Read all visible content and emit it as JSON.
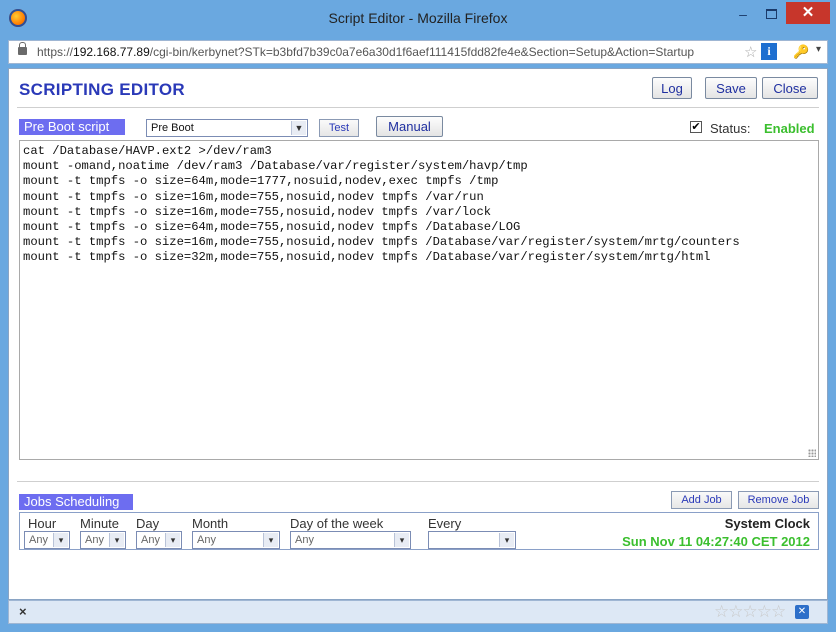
{
  "window": {
    "title": "Script Editor - Mozilla Firefox",
    "minimize": "–",
    "close": "✕"
  },
  "urlbar": {
    "scheme": "https://",
    "host": "192.168.77.89",
    "path": "/cgi-bin/kerbynet?STk=b3bfd7b39c0a7e6a30d1f6aef111415fdd82fe4e&Section=Setup&Action=Startup"
  },
  "page": {
    "heading": "SCRIPTING EDITOR",
    "buttons": {
      "log": "Log",
      "save": "Save",
      "close": "Close"
    },
    "script_tag": "Pre Boot script",
    "script_select": "Pre Boot",
    "test_button": "Test",
    "manual_button": "Manual",
    "status_checked": "✔",
    "status_label": "Status:",
    "status_value": "Enabled",
    "script_lines": [
      "cat /Database/HAVP.ext2 >/dev/ram3",
      "mount -omand,noatime /dev/ram3 /Database/var/register/system/havp/tmp",
      "mount -t tmpfs -o size=64m,mode=1777,nosuid,nodev,exec tmpfs /tmp",
      "mount -t tmpfs -o size=16m,mode=755,nosuid,nodev tmpfs /var/run",
      "mount -t tmpfs -o size=16m,mode=755,nosuid,nodev tmpfs /var/lock",
      "mount -t tmpfs -o size=64m,mode=755,nosuid,nodev tmpfs /Database/LOG",
      "mount -t tmpfs -o size=16m,mode=755,nosuid,nodev tmpfs /Database/var/register/system/mrtg/counters",
      "mount -t tmpfs -o size=32m,mode=755,nosuid,nodev tmpfs /Database/var/register/system/mrtg/html"
    ]
  },
  "jobs": {
    "tag": "Jobs Scheduling",
    "add_button": "Add Job",
    "remove_button": "Remove Job",
    "columns": {
      "hour": "Hour",
      "minute": "Minute",
      "day": "Day",
      "month": "Month",
      "dow": "Day of the week",
      "every": "Every"
    },
    "values": {
      "hour": "Any",
      "minute": "Any",
      "day": "Any",
      "month": "Any",
      "dow": "Any",
      "every": ""
    },
    "clock_label": "System Clock",
    "clock_value": "Sun Nov 11 04:27:40 CET 2012"
  },
  "statusbar": {
    "close_glyph": "×",
    "stars": "☆☆☆☆☆"
  },
  "icons": {
    "accent": "#2a39b8",
    "enabled_color": "#3bbf2e",
    "tag_color": "#6d6df0"
  }
}
